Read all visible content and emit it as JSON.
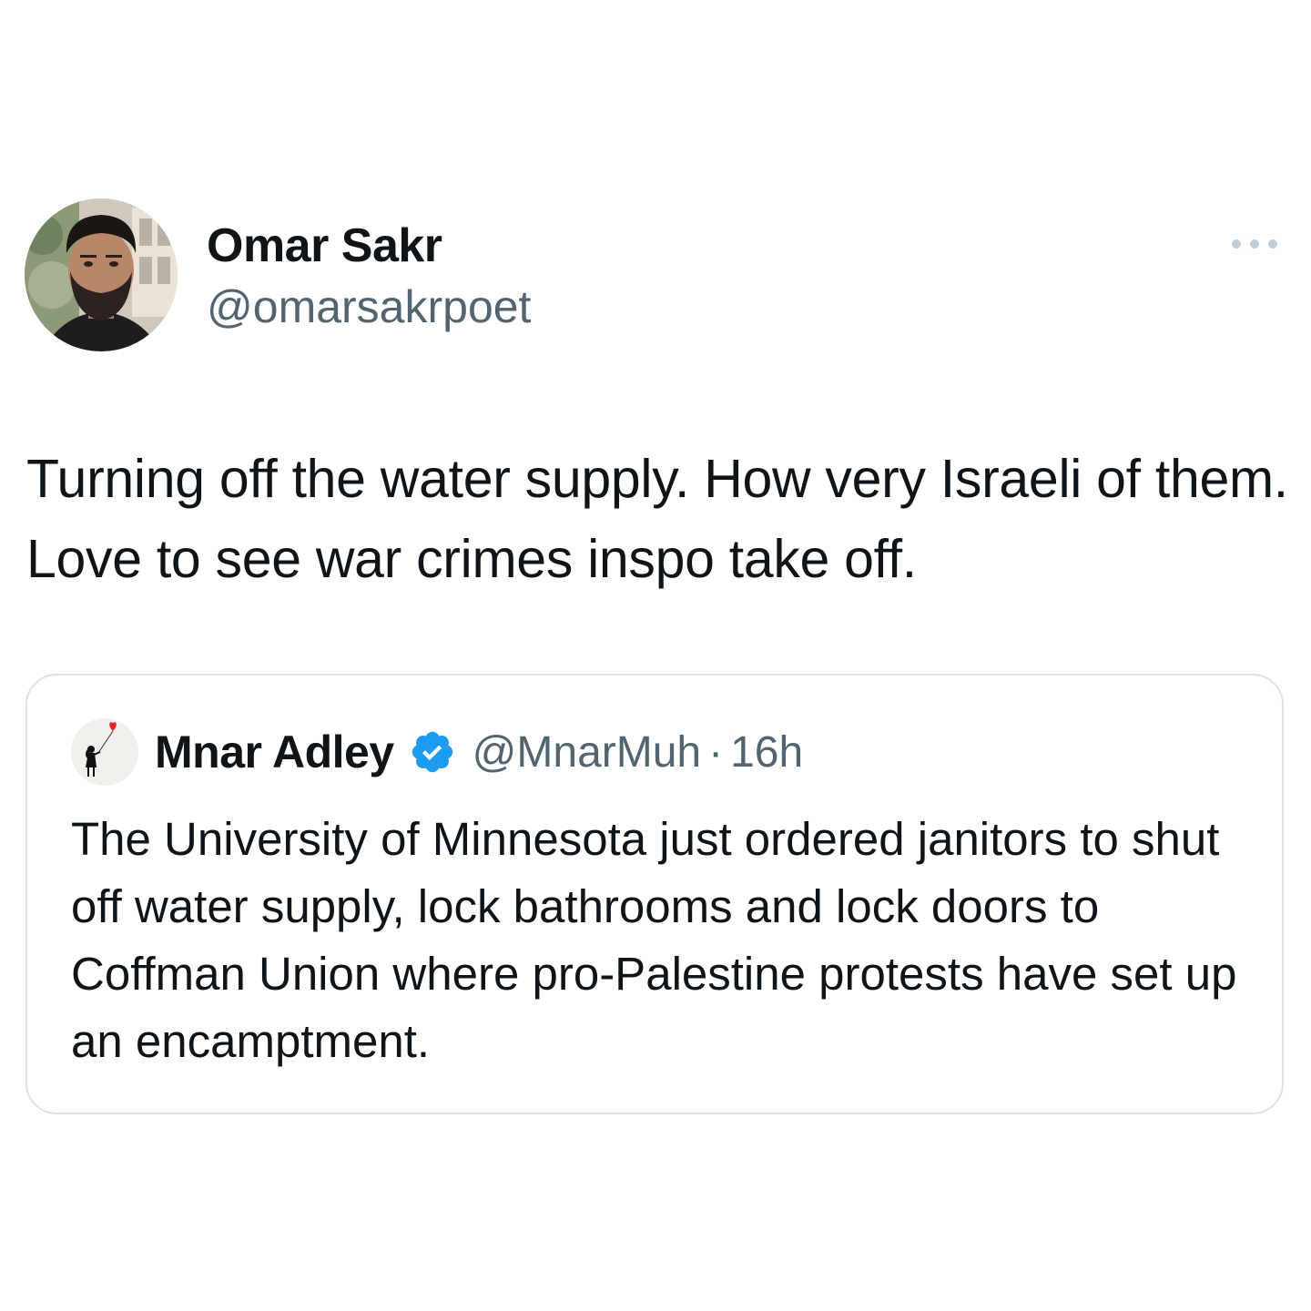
{
  "tweet": {
    "author": {
      "name": "Omar Sakr",
      "handle": "@omarsakrpoet",
      "avatar_icon": "profile-photo"
    },
    "more_icon": "ellipsis-icon",
    "text": "Turning off the water supply. How very Israeli of them. Love to see war crimes inspo take off."
  },
  "quoted": {
    "author": {
      "name": "Mnar Adley",
      "handle": "@MnarMuh",
      "separator": "·",
      "time": "16h",
      "verified": true,
      "verified_icon": "verified-badge-icon",
      "avatar_icon": "girl-with-balloon-avatar"
    },
    "text": "The University of Minnesota just ordered janitors to shut off water supply, lock bathrooms and lock doors to Coffman Union where pro-Palestine protests have set up an encamptment."
  },
  "colors": {
    "text_primary": "#0f1419",
    "text_secondary": "#536471",
    "border": "#dde3e8",
    "verified_blue": "#1d9bf0",
    "balloon_red": "#e0262a"
  }
}
